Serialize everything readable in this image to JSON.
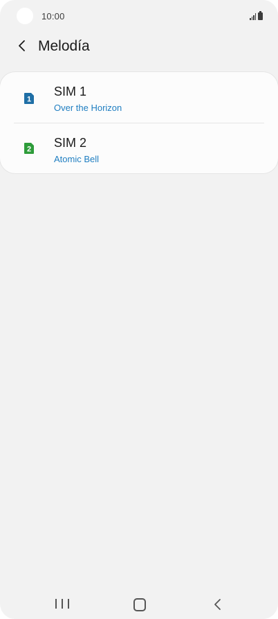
{
  "status_bar": {
    "time": "10:00"
  },
  "header": {
    "title": "Melodía",
    "back_icon": "chevron-left-icon"
  },
  "sims": [
    {
      "label": "SIM 1",
      "ringtone": "Over the Horizon",
      "badge": "1",
      "color": "#1f6fa6"
    },
    {
      "label": "SIM 2",
      "ringtone": "Atomic Bell",
      "badge": "2",
      "color": "#2e9c3a"
    }
  ],
  "nav": {
    "recent_icon": "recent-apps-icon",
    "home_icon": "home-icon",
    "back_icon": "back-icon"
  },
  "colors": {
    "background": "#f2f2f2",
    "card": "#fcfcfc",
    "accent_link": "#1f7ec1"
  }
}
